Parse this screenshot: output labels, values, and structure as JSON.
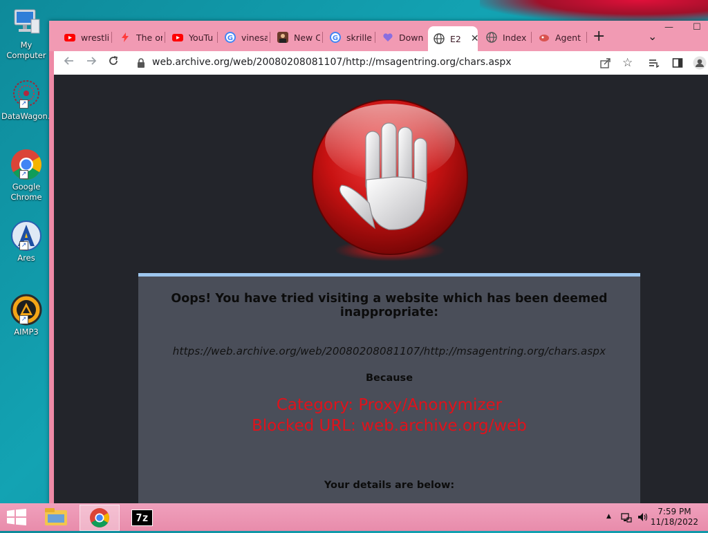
{
  "desktop": {
    "icons": [
      {
        "label": "My Computer"
      },
      {
        "label": "DataWagon..."
      },
      {
        "label": "Google Chrome"
      },
      {
        "label": "Ares"
      },
      {
        "label": "AIMP3"
      }
    ]
  },
  "browser": {
    "tabs": [
      {
        "label": "wrestli",
        "icon": "youtube-icon"
      },
      {
        "label": "The or",
        "icon": "bolt-icon"
      },
      {
        "label": "YouTu",
        "icon": "youtube-icon"
      },
      {
        "label": "vinesa",
        "icon": "google-icon"
      },
      {
        "label": "New C",
        "icon": "avatar-icon"
      },
      {
        "label": "skrille",
        "icon": "google-icon"
      },
      {
        "label": "Down",
        "icon": "heart-icon"
      },
      {
        "label": "E2",
        "icon": "globe-icon",
        "active": true
      },
      {
        "label": "Index",
        "icon": "globe-icon"
      },
      {
        "label": "Agent",
        "icon": "agent-icon"
      }
    ],
    "new_tab": "+",
    "tab_menu": "⌄",
    "window_controls": {
      "minimize": "—",
      "maximize": "☐"
    },
    "address": "web.archive.org/web/20080208081107/http://msagentring.org/chars.aspx"
  },
  "page": {
    "oops": "Oops! You have tried visiting a website which has been deemed inappropriate:",
    "blocked_full_url": "https://web.archive.org/web/20080208081107/http://msagentring.org/chars.aspx",
    "because": "Because",
    "category": "Category: Proxy/Anonymizer",
    "blocked_url": "Blocked URL: web.archive.org/web",
    "details": "Your details are below:"
  },
  "taskbar": {
    "time": "7:59 PM",
    "date": "11/18/2022",
    "seven_zip_label": "7z"
  },
  "colors": {
    "accent_pink": "#f19ab3",
    "alert_red": "#e0121b",
    "panel": "#4a4e59"
  }
}
